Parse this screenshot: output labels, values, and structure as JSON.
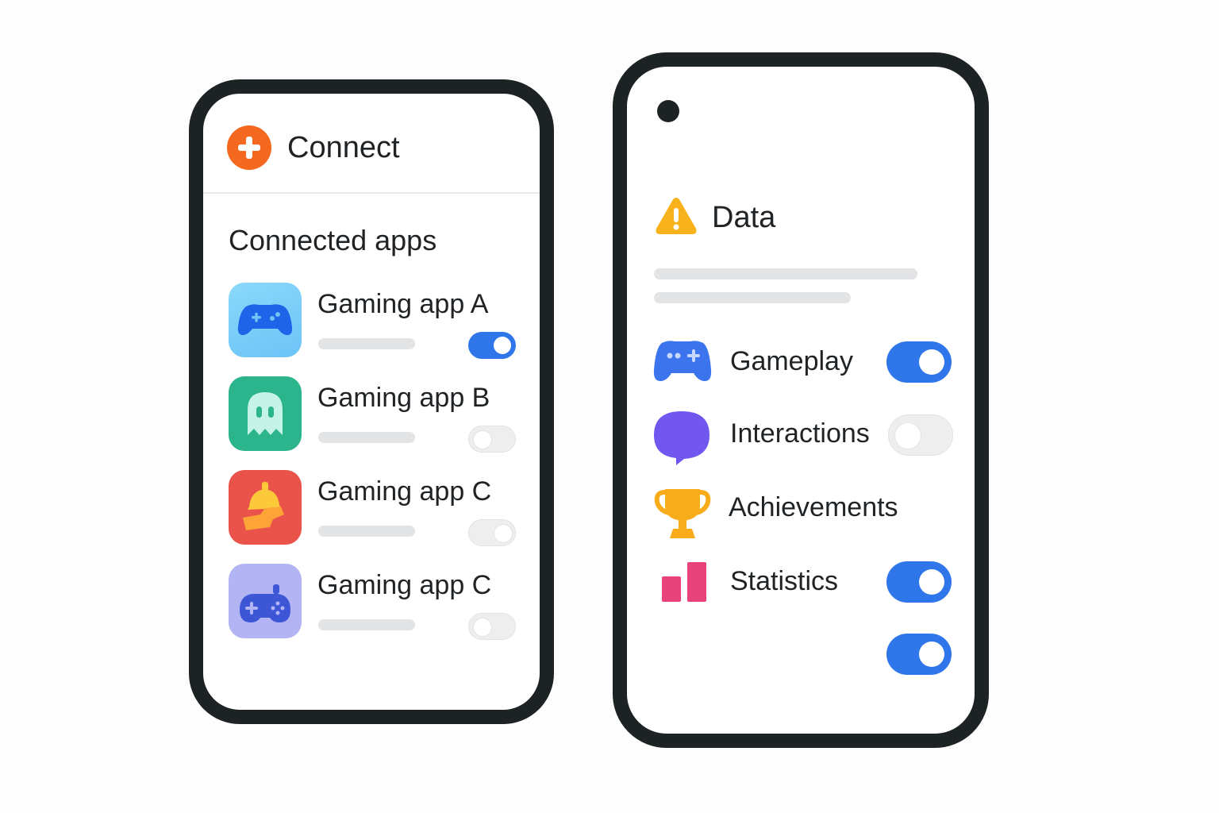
{
  "left_phone": {
    "header": {
      "title": "Connect",
      "icon": "plus-circle-icon",
      "icon_color": "#f4691f"
    },
    "section_title": "Connected apps",
    "apps": [
      {
        "name": "Gaming app A",
        "icon": "gamepad-icon",
        "enabled": true
      },
      {
        "name": "Gaming app B",
        "icon": "ghost-icon",
        "enabled": false
      },
      {
        "name": "Gaming app C",
        "icon": "bell-icon",
        "enabled": false
      },
      {
        "name": "Gaming app C",
        "icon": "controller-icon",
        "enabled": false
      }
    ]
  },
  "right_phone": {
    "header": {
      "title": "Data",
      "icon": "warning-icon",
      "icon_color": "#f7b21c"
    },
    "permissions": [
      {
        "label": "Gameplay",
        "icon": "gamepad-icon",
        "enabled": true
      },
      {
        "label": "Interactions",
        "icon": "chat-bubble-icon",
        "enabled": false
      },
      {
        "label": "Achievements",
        "icon": "trophy-icon"
      },
      {
        "label": "Statistics",
        "icon": "bar-chart-icon",
        "enabled": true
      }
    ],
    "extra_toggle": {
      "enabled": true
    }
  },
  "colors": {
    "accent_blue": "#2f76ea",
    "phone_frame": "#1d2325",
    "toggle_off": "#eeeeef"
  }
}
